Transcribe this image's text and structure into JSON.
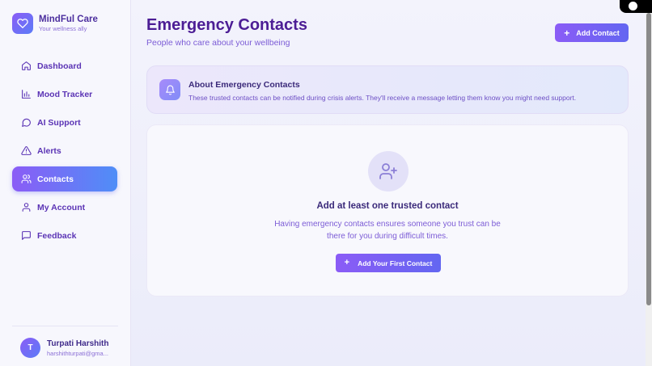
{
  "brand": {
    "name": "MindFul Care",
    "tagline": "Your wellness ally",
    "icon": "heart-icon"
  },
  "nav": {
    "items": [
      {
        "label": "Dashboard",
        "icon": "home-icon",
        "active": false
      },
      {
        "label": "Mood Tracker",
        "icon": "bar-chart-icon",
        "active": false
      },
      {
        "label": "AI Support",
        "icon": "chat-bubble-icon",
        "active": false
      },
      {
        "label": "Alerts",
        "icon": "warning-triangle-icon",
        "active": false
      },
      {
        "label": "Contacts",
        "icon": "users-icon",
        "active": true
      },
      {
        "label": "My Account",
        "icon": "user-icon",
        "active": false
      },
      {
        "label": "Feedback",
        "icon": "message-square-icon",
        "active": false
      }
    ]
  },
  "user": {
    "initial": "T",
    "name": "Turpati Harshith",
    "email": "harshithturpati@gma..."
  },
  "header": {
    "title": "Emergency Contacts",
    "subtitle": "People who care about your wellbeing",
    "add_button": "Add Contact"
  },
  "info": {
    "title": "About Emergency Contacts",
    "text": "These trusted contacts can be notified during crisis alerts. They'll receive a message letting them know you might need support.",
    "icon": "bell-icon"
  },
  "empty_state": {
    "icon": "user-plus-icon",
    "title": "Add at least one trusted contact",
    "description": "Having emergency contacts ensures someone you trust can be there for you during difficult times.",
    "button": "Add Your First Contact"
  },
  "colors": {
    "accent": "#8b5cf6",
    "accent_end": "#4f8ef7",
    "title": "#4c1d95",
    "text_muted": "#7c5cd6"
  }
}
